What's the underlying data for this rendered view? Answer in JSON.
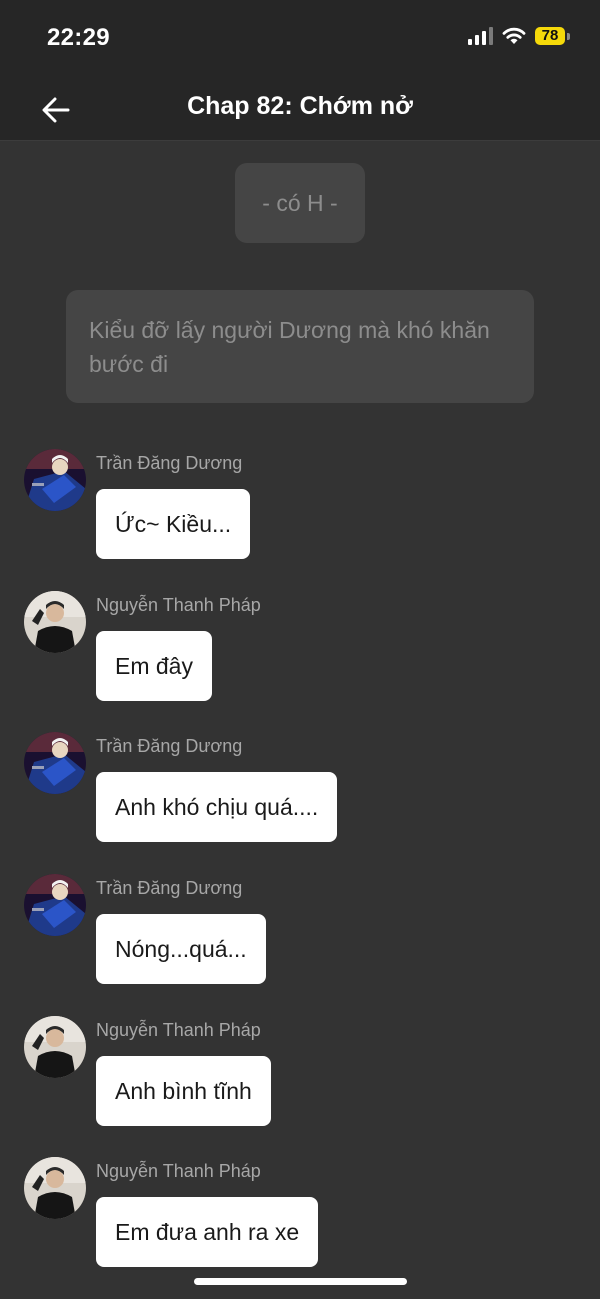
{
  "status_bar": {
    "time": "22:29",
    "battery": "78",
    "signal_icon": "cellular-signal-icon",
    "wifi_icon": "wifi-icon"
  },
  "nav": {
    "back_icon": "arrow-left-icon",
    "title": "Chap 82: Chớm nở"
  },
  "narrations": [
    {
      "text": "- có H -"
    },
    {
      "text": "Kiểu đỡ lấy người Dương mà khó khăn bước đi"
    }
  ],
  "messages": [
    {
      "sender": "Trần Đăng Dương",
      "text": "Ức~ Kiều...",
      "avatar": "duong"
    },
    {
      "sender": "Nguyễn Thanh Pháp",
      "text": "Em đây",
      "avatar": "phap"
    },
    {
      "sender": "Trần Đăng Dương",
      "text": "Anh khó chịu quá....",
      "avatar": "duong"
    },
    {
      "sender": "Trần Đăng Dương",
      "text": "Nóng...quá...",
      "avatar": "duong"
    },
    {
      "sender": "Nguyễn Thanh Pháp",
      "text": "Anh bình tĩnh",
      "avatar": "phap"
    },
    {
      "sender": "Nguyễn Thanh Pháp",
      "text": "Em đưa anh ra xe",
      "avatar": "phap"
    }
  ],
  "colors": {
    "background": "#333333",
    "header": "#262626",
    "narration_bg": "#454545",
    "narration_text": "#8d8d8d",
    "bubble_bg": "#ffffff",
    "sender_text": "#a7a7a7",
    "battery": "#f5d90a"
  }
}
